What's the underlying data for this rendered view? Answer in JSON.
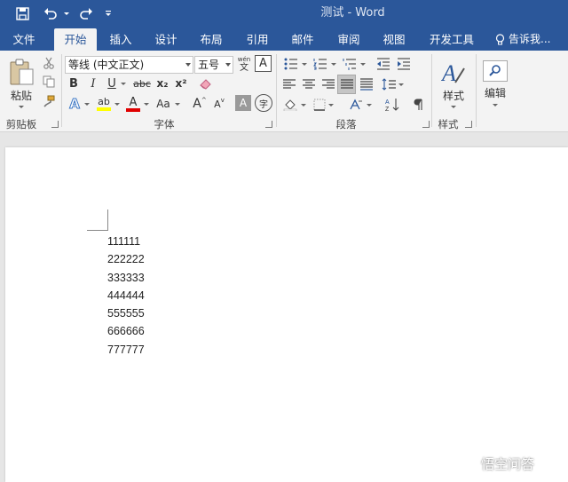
{
  "window": {
    "title": "测试 - Word"
  },
  "tabs": [
    "文件",
    "开始",
    "插入",
    "设计",
    "布局",
    "引用",
    "邮件",
    "审阅",
    "视图",
    "开发工具"
  ],
  "active_tab": "开始",
  "tell_me": "告诉我...",
  "ribbon": {
    "clipboard": {
      "paste_label": "粘贴",
      "group_label": "剪贴板"
    },
    "font": {
      "font_name": "等线 (中文正文)",
      "font_size": "五号",
      "phonetic_top": "wén",
      "phonetic_bottom": "文",
      "border_char": "A",
      "bold": "B",
      "italic": "I",
      "underline": "U",
      "strikethrough": "abc",
      "subscript": "x₂",
      "superscript": "x²",
      "text_effects": "A",
      "highlight": "ab",
      "font_color": "A",
      "change_case": "Aa",
      "grow_font": "A",
      "shrink_font": "A",
      "char_shading": "A",
      "enclose_char": "字",
      "group_label": "字体"
    },
    "paragraph": {
      "group_label": "段落"
    },
    "styles": {
      "styles_label": "样式",
      "group_label": "样式"
    },
    "editing": {
      "editing_label": "编辑"
    }
  },
  "document": {
    "lines": [
      "111111",
      "222222",
      "333333",
      "444444",
      "555555",
      "666666",
      "777777"
    ]
  },
  "watermark": {
    "text": "悟空问答"
  },
  "colors": {
    "title_bar": "#2b579a",
    "ribbon_bg": "#f3f3f3",
    "highlight_yellow": "#ffff00",
    "font_color_red": "#e00000"
  }
}
